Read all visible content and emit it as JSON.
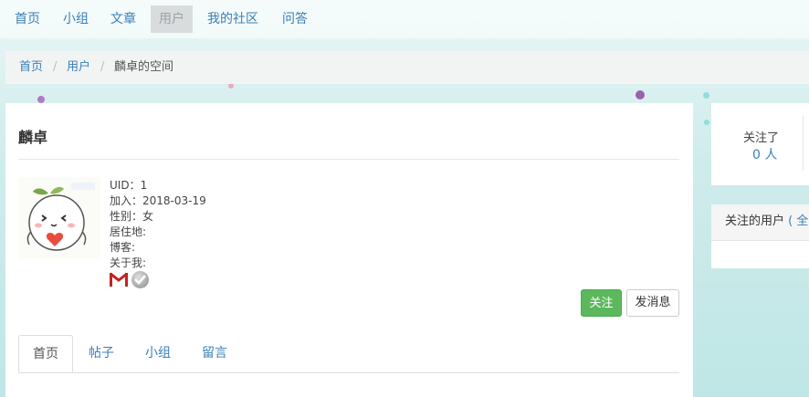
{
  "nav": {
    "items": [
      {
        "label": "首页"
      },
      {
        "label": "小组"
      },
      {
        "label": "文章"
      },
      {
        "label": "用户"
      },
      {
        "label": "我的社区"
      },
      {
        "label": "问答"
      }
    ],
    "active_index": 3
  },
  "breadcrumb": {
    "home": "首页",
    "users": "用户",
    "current": "麟卓的空间",
    "separator": "/"
  },
  "profile": {
    "name": "麟卓",
    "uid": "UID：1",
    "joined": "加入：2018-03-19",
    "gender": "性别：女",
    "location": "居住地:",
    "blog": "博客:",
    "about": "关于我:"
  },
  "actions": {
    "follow_label": "关注",
    "message_label": "发消息"
  },
  "tabs": [
    {
      "label": "首页"
    },
    {
      "label": "帖子"
    },
    {
      "label": "小组"
    },
    {
      "label": "留言"
    }
  ],
  "stats": {
    "following_label": "关注了",
    "following_value": "0 人"
  },
  "following_panel": {
    "title": "关注的用户",
    "link": "( 全"
  },
  "colors": {
    "link": "#3a7fb8",
    "follow_button": "#5cb85c"
  }
}
